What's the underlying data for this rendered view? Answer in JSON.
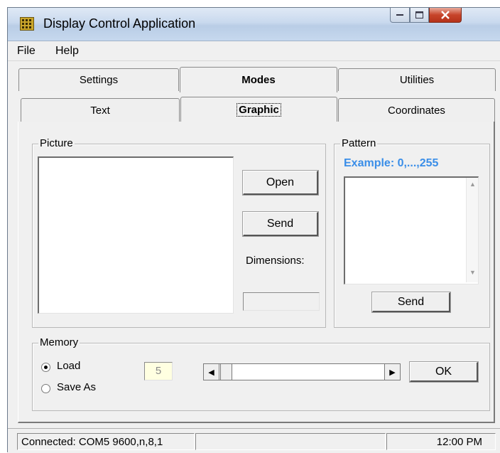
{
  "window": {
    "title": "Display Control Application"
  },
  "menu": {
    "items": [
      "File",
      "Help"
    ]
  },
  "tabs_top": [
    "Settings",
    "Modes",
    "Utilities"
  ],
  "tabs_sub": [
    "Text",
    "Graphic",
    "Coordinates"
  ],
  "picture": {
    "group_label": "Picture",
    "open_label": "Open",
    "send_label": "Send",
    "dimensions_label": "Dimensions:",
    "dimensions_value": ""
  },
  "pattern": {
    "group_label": "Pattern",
    "example": "Example: 0,...,255",
    "send_label": "Send"
  },
  "memory": {
    "group_label": "Memory",
    "load_label": "Load",
    "save_as_label": "Save As",
    "selected": "Load",
    "slot_value": "5",
    "ok_label": "OK",
    "slider_position": 0
  },
  "status": {
    "connection": "Connected: COM5 9600,n,8,1",
    "middle": "",
    "time": "12:00 PM"
  },
  "colors": {
    "accent_blue": "#3a8ee8",
    "close_red": "#c7442a"
  }
}
